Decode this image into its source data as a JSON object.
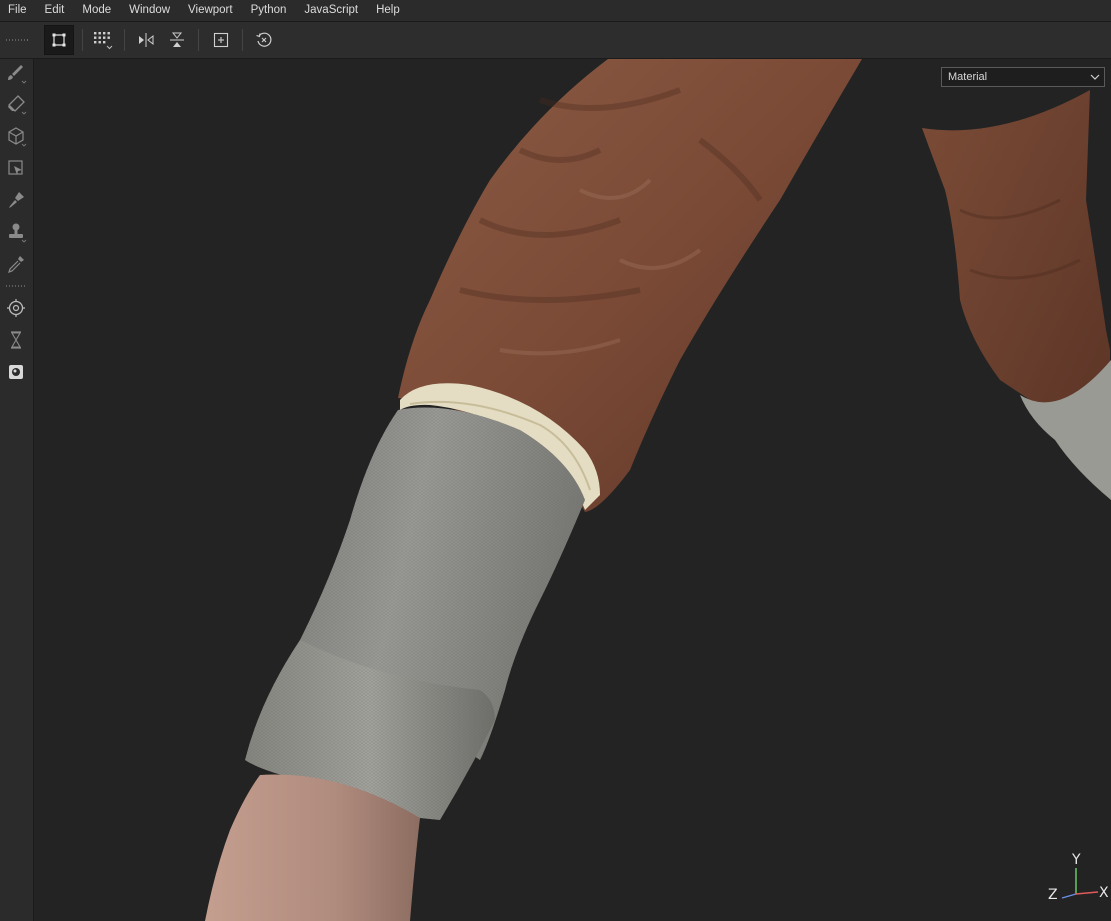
{
  "menu": [
    "File",
    "Edit",
    "Mode",
    "Window",
    "Viewport",
    "Python",
    "JavaScript",
    "Help"
  ],
  "toolbar": {
    "buttons": [
      "selection-mode-icon",
      "grid-select-icon",
      "mirror-x-icon",
      "mirror-y-icon",
      "frame-selection-icon",
      "reset-camera-icon"
    ]
  },
  "tools": [
    "brush-icon",
    "eraser-icon",
    "projection-icon",
    "polygon-fill-icon",
    "smudge-icon",
    "clone-stamp-icon",
    "color-picker-icon",
    "physics-icon",
    "bake-icon",
    "material-picker-icon"
  ],
  "viewport": {
    "shading_mode": "Material",
    "axis": {
      "x": "X",
      "y": "Y",
      "z": "Z"
    },
    "colors": {
      "jacket": "#7a4a36",
      "sweater": "#8e8e8a",
      "lining": "#e4ddc3",
      "skin": "#b08c7e",
      "background": "#232323"
    }
  }
}
